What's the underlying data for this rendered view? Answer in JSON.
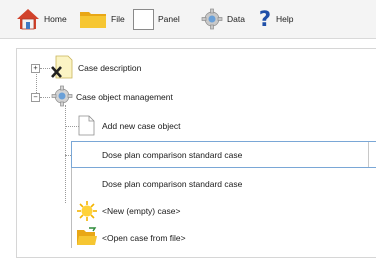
{
  "toolbar": {
    "items": [
      {
        "label": "Home",
        "icon": "home-icon"
      },
      {
        "label": "File",
        "icon": "folder-icon"
      },
      {
        "label": "Panel",
        "icon": "panel-icon"
      },
      {
        "label": "Data",
        "icon": "data-gear-icon"
      },
      {
        "label": "Help",
        "icon": "help-question-icon"
      }
    ]
  },
  "tree": {
    "nodes": [
      {
        "label": "Case description",
        "expander": "+"
      },
      {
        "label": "Case object management",
        "expander": "−"
      },
      {
        "label": "Add new case object"
      }
    ],
    "combo": {
      "value": "Dose plan comparison standard case"
    },
    "dropdown": {
      "options": [
        {
          "label": "Dose plan comparison standard case"
        },
        {
          "label": "<New (empty) case>",
          "icon": "sun-new-icon"
        },
        {
          "label": "<Open case from file>",
          "icon": "open-folder-icon"
        }
      ]
    }
  },
  "colors": {
    "accent": "#1f4fa8",
    "folder": "#f2b824",
    "home_roof": "#d1422b"
  }
}
